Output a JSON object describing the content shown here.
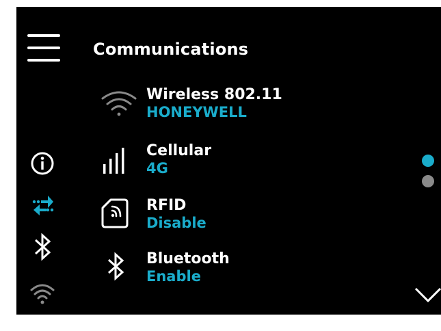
{
  "colors": {
    "background": "#000000",
    "text": "#ffffff",
    "accent": "#1aaccb",
    "inactive": "#8a8a8a"
  },
  "header": {
    "title": "Communications",
    "menu_icon": "hamburger-menu-icon"
  },
  "sidebar": {
    "items": [
      {
        "icon": "info-icon",
        "active": false
      },
      {
        "icon": "transfer-arrows-icon",
        "active": true
      },
      {
        "icon": "bluetooth-icon",
        "active": false
      },
      {
        "icon": "wifi-icon",
        "active": false
      }
    ]
  },
  "list": {
    "items": [
      {
        "icon": "wifi-icon",
        "label": "Wireless 802.11",
        "value": "HONEYWELL"
      },
      {
        "icon": "cellular-signal-icon",
        "label": "Cellular",
        "value": "4G"
      },
      {
        "icon": "rfid-icon",
        "label": "RFID",
        "value": "Disable"
      },
      {
        "icon": "bluetooth-icon",
        "label": "Bluetooth",
        "value": "Enable"
      }
    ]
  },
  "pager": {
    "page_count": 2,
    "current_page": 1,
    "next_icon": "chevron-down-icon"
  }
}
